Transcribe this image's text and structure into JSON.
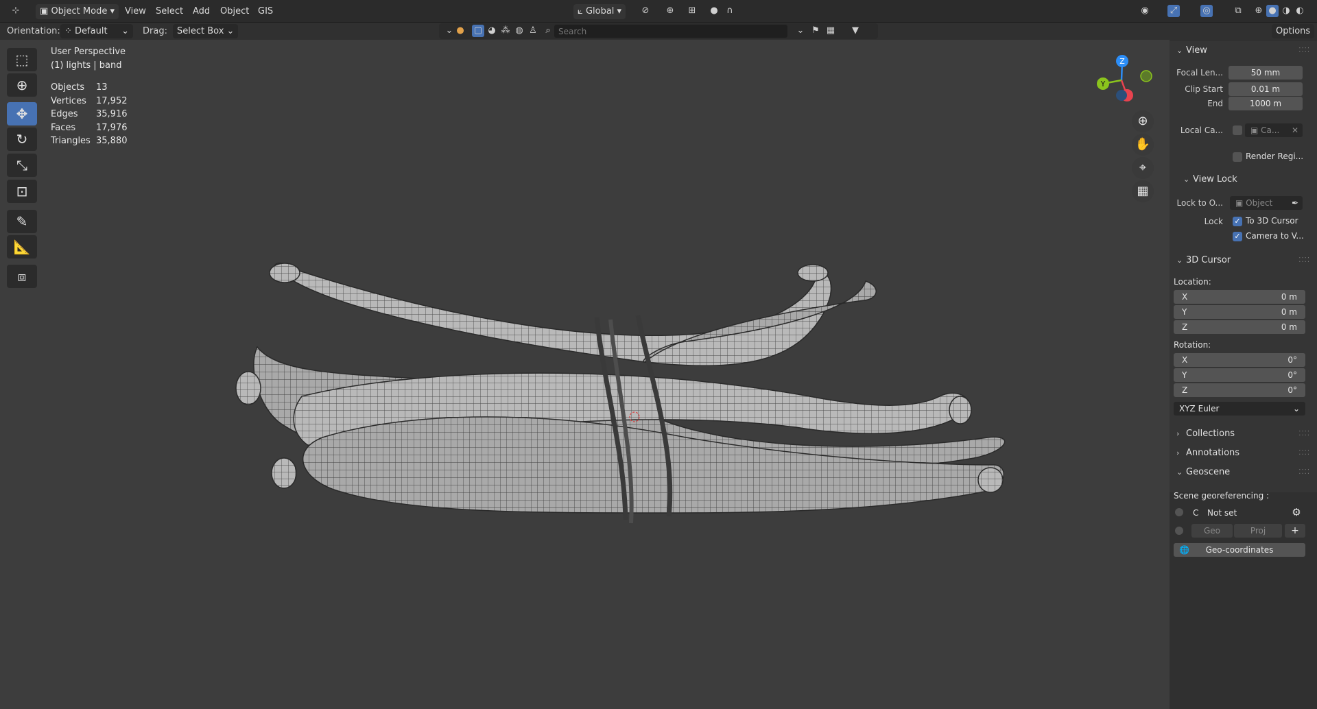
{
  "topbar": {
    "mode": "Object Mode",
    "menu": [
      "View",
      "Select",
      "Add",
      "Object",
      "GIS"
    ],
    "transform_orientation": "Global"
  },
  "options_bar": {
    "orientation_label": "Orientation:",
    "orientation_value": "Default",
    "drag_label": "Drag:",
    "drag_value": "Select Box",
    "search_placeholder": "Search",
    "options_label": "Options"
  },
  "viewport": {
    "perspective": "User Perspective",
    "collection": "(1) lights | band",
    "stats": [
      {
        "label": "Objects",
        "value": "13"
      },
      {
        "label": "Vertices",
        "value": "17,952"
      },
      {
        "label": "Edges",
        "value": "35,916"
      },
      {
        "label": "Faces",
        "value": "17,976"
      },
      {
        "label": "Triangles",
        "value": "35,880"
      }
    ],
    "gizmo": {
      "x": "X",
      "y": "Y",
      "z": "Z"
    },
    "colors": {
      "x_axis": "#e8434f",
      "y_axis": "#8bc41d",
      "z_axis": "#2c8ef8",
      "active_tool": "#4772b3"
    }
  },
  "sidebar": {
    "view": {
      "title": "View",
      "focal_length_label": "Focal Len...",
      "focal_length": "50 mm",
      "clip_start_label": "Clip Start",
      "clip_start": "0.01 m",
      "end_label": "End",
      "end": "1000 m",
      "local_camera_label": "Local Ca...",
      "local_camera_value": "Ca...",
      "render_region": "Render Regi..."
    },
    "view_lock": {
      "title": "View Lock",
      "lock_to_object_label": "Lock to O...",
      "lock_to_object_placeholder": "Object",
      "lock_label": "Lock",
      "to_3d_cursor": "To 3D Cursor",
      "camera_to_view": "Camera to V..."
    },
    "cursor": {
      "title": "3D Cursor",
      "location_label": "Location:",
      "location": [
        {
          "axis": "X",
          "value": "0 m"
        },
        {
          "axis": "Y",
          "value": "0 m"
        },
        {
          "axis": "Z",
          "value": "0 m"
        }
      ],
      "rotation_label": "Rotation:",
      "rotation": [
        {
          "axis": "X",
          "value": "0°"
        },
        {
          "axis": "Y",
          "value": "0°"
        },
        {
          "axis": "Z",
          "value": "0°"
        }
      ],
      "rotation_mode": "XYZ Euler"
    },
    "collapsed_panels": [
      "Collections",
      "Annotations"
    ],
    "geoscene": {
      "title": "Geoscene",
      "georef_label": "Scene georeferencing :",
      "crs_letter": "C",
      "crs_status": "Not set",
      "geo_label": "Geo",
      "proj_label": "Proj",
      "geo_coordinates_button": "Geo-coordinates"
    }
  }
}
